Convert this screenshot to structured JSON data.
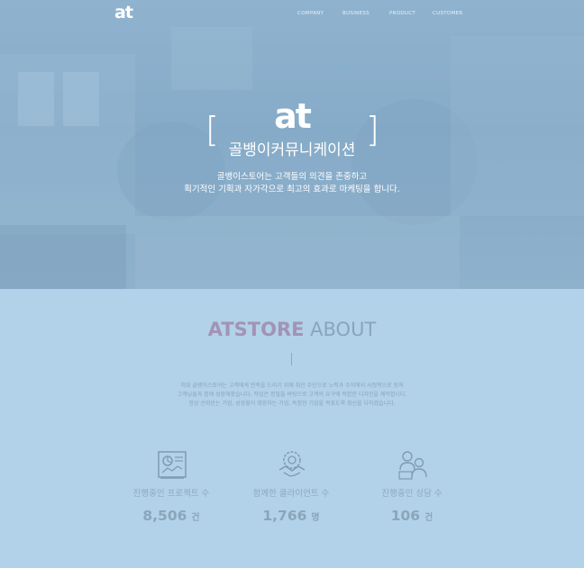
{
  "header": {
    "logo_text": "at",
    "nav": [
      {
        "label": "COMPANY"
      },
      {
        "label": "BUSINESS"
      },
      {
        "label": "PRODUCT"
      },
      {
        "label": "CUSTOMER"
      }
    ]
  },
  "hero": {
    "logo_text": "at",
    "bracket_left": "[",
    "bracket_right": "]",
    "company_name": "골뱅이커뮤니케이션",
    "description_line1": "골뱅이스토어는 고객들의 의견을 존중하고",
    "description_line2": "획기적인 기획과 자가각으로 최고의 효과로 마케팅을 합니다."
  },
  "about": {
    "title_brand": "ATSTORE",
    "title_word": "ABOUT",
    "paragraph_line1": "저희 골뱅이스토어는 고객에게 만족을 드리기 위해 최선 수단으로 노력과 수치에서 사정적으로 등쳐",
    "paragraph_line2": "고객님들과 함께 성장해왔습니다. 작업은 정밀을 바탕으로 고객의 요구에 적합한 디자인을 제작합니다.",
    "paragraph_line3": "항상 신뢰받는 기업, 성장할이 희망하는 기업, 독창한 기업을 목표도록 최선을 다하겠습니다."
  },
  "stats": [
    {
      "icon": "presentation-chart-icon",
      "label": "진행중인 프로젝트 수",
      "value": "8,506",
      "unit": "건"
    },
    {
      "icon": "handshake-gear-icon",
      "label": "함께한 클라이언트 수",
      "value": "1,766",
      "unit": "명"
    },
    {
      "icon": "consultation-people-icon",
      "label": "진행중인 상담 수",
      "value": "106",
      "unit": "건"
    }
  ],
  "colors": {
    "hero_overlay": "#8fb3cf",
    "section_bg": "#b1d2e8",
    "brand_accent": "#a393b6",
    "muted_text": "#8aa5bb",
    "white": "#ffffff"
  }
}
